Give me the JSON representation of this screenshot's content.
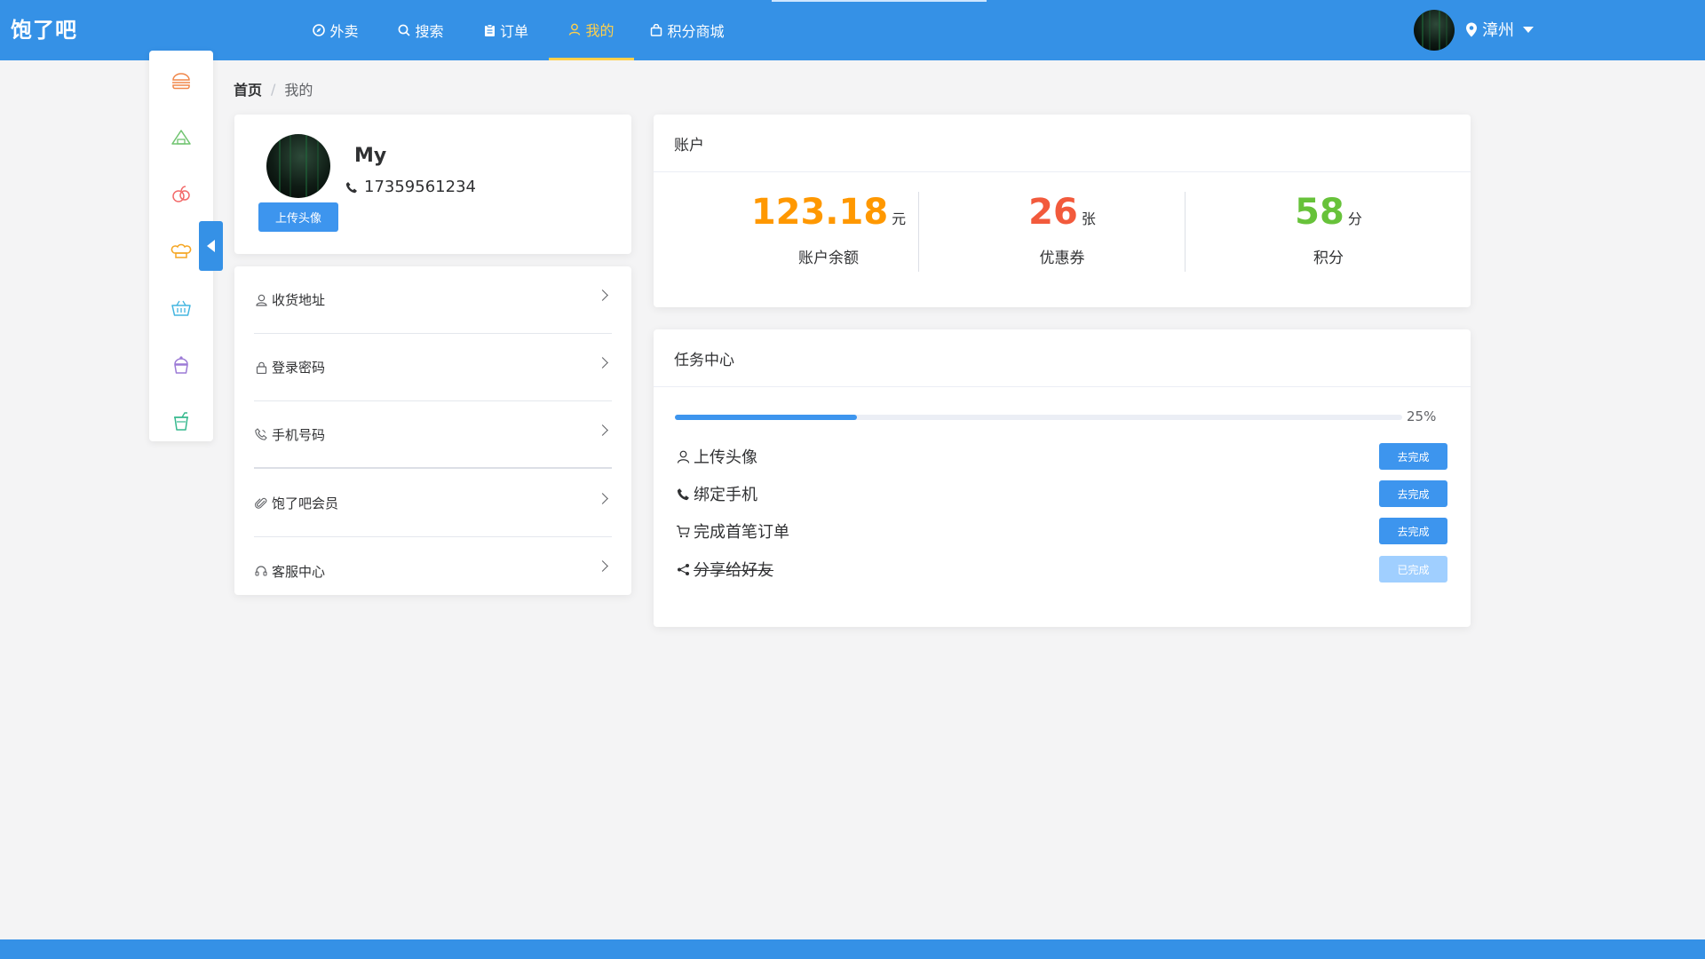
{
  "app": {
    "logo": "饱了吧"
  },
  "nav": [
    {
      "label": "外卖",
      "icon": "compass-icon"
    },
    {
      "label": "搜索",
      "icon": "search-icon"
    },
    {
      "label": "订单",
      "icon": "clipboard-icon"
    },
    {
      "label": "我的",
      "icon": "user-icon",
      "active": true
    },
    {
      "label": "积分商城",
      "icon": "shopping-bag-icon"
    }
  ],
  "header": {
    "city": "漳州"
  },
  "sidebar": {
    "icons": [
      "burger-icon",
      "rice-ball-icon",
      "fruit-icon",
      "chef-hat-icon",
      "basket-icon",
      "cupcake-icon",
      "drink-icon"
    ],
    "icon_colors": [
      "#f0874a",
      "#6fc36f",
      "#f26a6a",
      "#f5a623",
      "#42b5e0",
      "#9c7ad6",
      "#36b98e"
    ]
  },
  "breadcrumb": {
    "home": "首页",
    "separator": "/",
    "current": "我的"
  },
  "profile": {
    "name": "My",
    "phone": "17359561234",
    "upload_label": "上传头像"
  },
  "menu": [
    {
      "label": "收货地址",
      "icon": "location-user-icon"
    },
    {
      "label": "登录密码",
      "icon": "lock-icon"
    },
    {
      "label": "手机号码",
      "icon": "phone-outline-icon"
    },
    {
      "label": "饱了吧会员",
      "icon": "paperclip-icon"
    },
    {
      "label": "客服中心",
      "icon": "headset-icon"
    }
  ],
  "account": {
    "title": "账户",
    "stats": [
      {
        "value": "123.18",
        "unit": "元",
        "label": "账户余额",
        "color": "#ff9800"
      },
      {
        "value": "26",
        "unit": "张",
        "label": "优惠券",
        "color": "#f25a3c"
      },
      {
        "value": "58",
        "unit": "分",
        "label": "积分",
        "color": "#67c23a"
      }
    ]
  },
  "tasks": {
    "title": "任务中心",
    "progress": 25,
    "progress_text": "25%",
    "items": [
      {
        "label": "上传头像",
        "icon": "user-icon",
        "button": "去完成",
        "done": false
      },
      {
        "label": "绑定手机",
        "icon": "phone-icon",
        "button": "去完成",
        "done": false
      },
      {
        "label": "完成首笔订单",
        "icon": "cart-icon",
        "button": "去完成",
        "done": false
      },
      {
        "label": "分享给好友",
        "icon": "share-icon",
        "button": "已完成",
        "done": true
      }
    ]
  },
  "colors": {
    "brand": "#3591e6",
    "button": "#3d95ee",
    "active_nav": "#ffd04b"
  }
}
